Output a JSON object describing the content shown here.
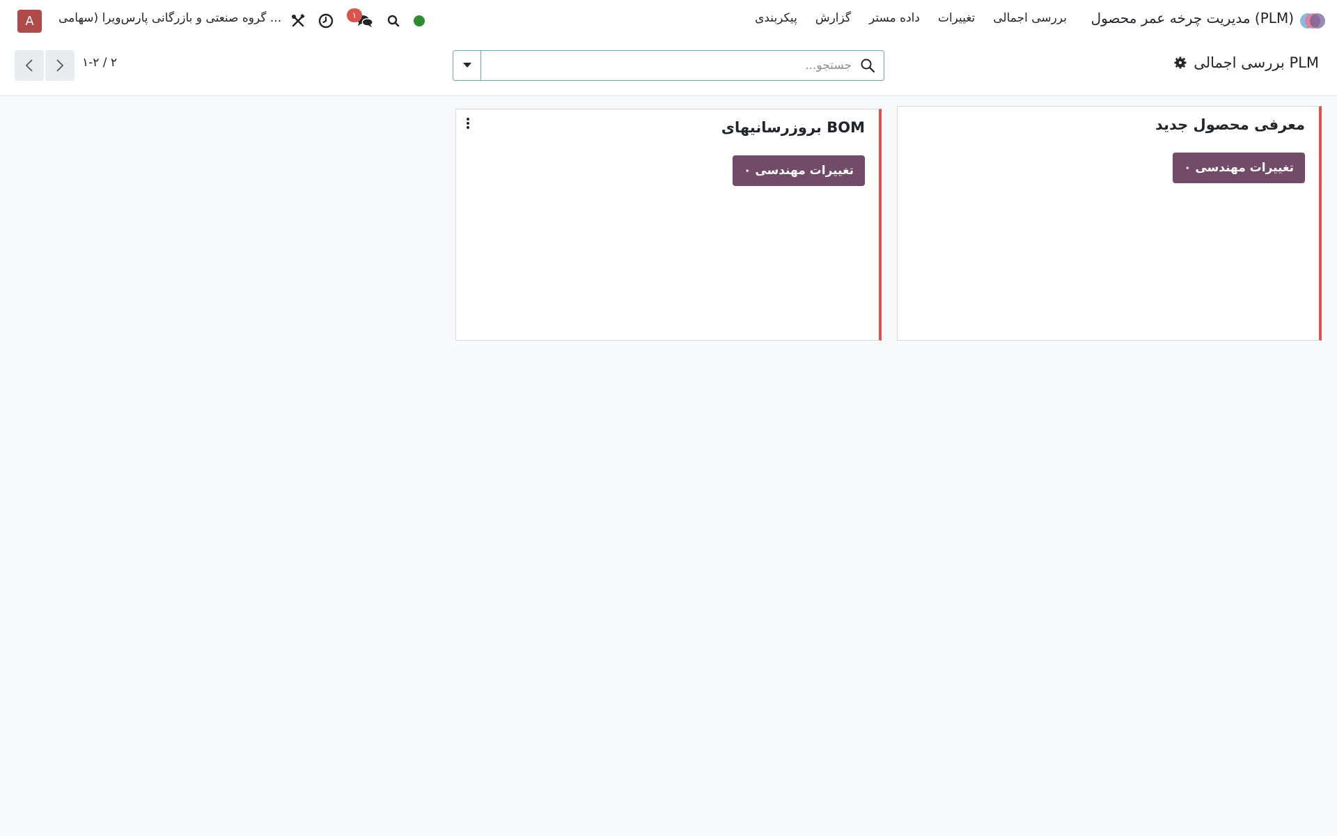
{
  "navbar": {
    "app_name": "مدیریت چرخه عمر محصول (PLM)",
    "menu": [
      "بررسی اجمالی",
      "تغییرات",
      "داده مستر",
      "گزارش",
      "پیکربندی"
    ],
    "messages_badge": "۱",
    "company_name": "گروه صنعتی و بازرگانی پارس‌ویرا (سهامی ...",
    "avatar_letter": "A",
    "status_color": "#2e8b2e"
  },
  "control_panel": {
    "breadcrumb": "بررسی اجمالی PLM",
    "search_placeholder": "جستجو...",
    "pager_value": "۱-۲ / ۲"
  },
  "cards": [
    {
      "title": "معرفی محصول جدید",
      "button_label": "۰ تغییرات مهندسی"
    },
    {
      "title": "بروزرسانیهای BOM",
      "button_label": "۰ تغییرات مهندسی"
    }
  ],
  "colors": {
    "accent": "#714b67",
    "card_stripe": "#d9534f",
    "background": "#f8f9fa"
  }
}
